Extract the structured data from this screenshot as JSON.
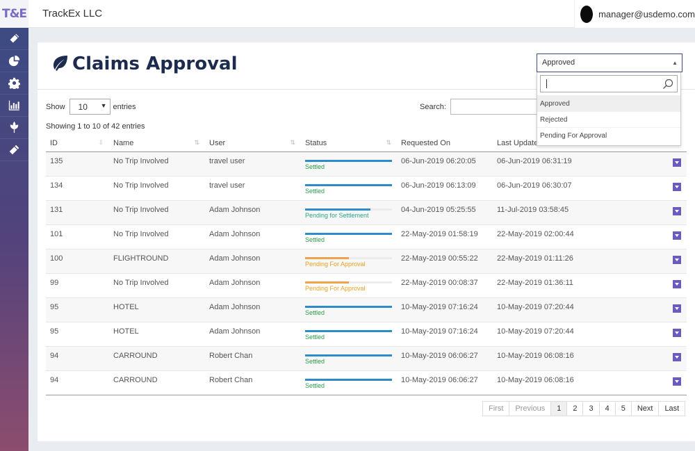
{
  "app": {
    "logo": "T&E",
    "company": "TrackEx LLC",
    "user_email": "manager@usdemo.com"
  },
  "sidebar": {
    "items": [
      {
        "name": "ticket-icon"
      },
      {
        "name": "pie-chart-icon"
      },
      {
        "name": "gear-icon"
      },
      {
        "name": "bar-chart-icon"
      },
      {
        "name": "leaf-icon"
      },
      {
        "name": "tag-icon"
      }
    ]
  },
  "page": {
    "title": "Claims Approval",
    "accent": "#3d4b83"
  },
  "status_filter": {
    "selected": "Approved",
    "options": [
      "Approved",
      "Rejected",
      "Pending For Approval"
    ]
  },
  "controls": {
    "show_label": "Show",
    "entries_value": "10",
    "entries_label": "entries",
    "search_label": "Search:",
    "info": "Showing 1 to 10 of 42 entries"
  },
  "table": {
    "columns": [
      "ID",
      "Name",
      "User",
      "Status",
      "Requested On",
      "Last Updated"
    ],
    "rows": [
      {
        "id": "135",
        "name": "No Trip Involved",
        "user": "travel user",
        "status": "Settled",
        "progress": 1.0,
        "color": "#2e8bc9",
        "text_color": "#2a9a4a",
        "requested": "06-Jun-2019 06:20:05",
        "updated": "06-Jun-2019 06:31:19"
      },
      {
        "id": "134",
        "name": "No Trip Involved",
        "user": "travel user",
        "status": "Settled",
        "progress": 1.0,
        "color": "#2e8bc9",
        "text_color": "#2a9a4a",
        "requested": "06-Jun-2019 06:13:09",
        "updated": "06-Jun-2019 06:30:07"
      },
      {
        "id": "131",
        "name": "No Trip Involved",
        "user": "Adam Johnson",
        "status": "Pending for Settlement",
        "progress": 0.75,
        "color": "#2e8bc9",
        "text_color": "#2aa38a",
        "requested": "04-Jun-2019 05:25:55",
        "updated": "11-Jul-2019 03:58:45"
      },
      {
        "id": "101",
        "name": "No Trip Involved",
        "user": "Adam Johnson",
        "status": "Settled",
        "progress": 1.0,
        "color": "#2e8bc9",
        "text_color": "#2a9a4a",
        "requested": "22-May-2019 01:58:19",
        "updated": "22-May-2019 02:00:44"
      },
      {
        "id": "100",
        "name": "FLIGHTROUND",
        "user": "Adam Johnson",
        "status": "Pending For Approval",
        "progress": 0.5,
        "color": "#f0a24a",
        "text_color": "#e8a020",
        "requested": "22-May-2019 00:55:22",
        "updated": "22-May-2019 01:11:26"
      },
      {
        "id": "99",
        "name": "No Trip Involved",
        "user": "Adam Johnson",
        "status": "Pending For Approval",
        "progress": 0.5,
        "color": "#f0a24a",
        "text_color": "#e8a020",
        "requested": "22-May-2019 00:08:37",
        "updated": "22-May-2019 01:36:11"
      },
      {
        "id": "95",
        "name": "HOTEL",
        "user": "Adam Johnson",
        "status": "Settled",
        "progress": 1.0,
        "color": "#2e8bc9",
        "text_color": "#2a9a4a",
        "requested": "10-May-2019 07:16:24",
        "updated": "10-May-2019 07:20:44"
      },
      {
        "id": "95",
        "name": "HOTEL",
        "user": "Adam Johnson",
        "status": "Settled",
        "progress": 1.0,
        "color": "#2e8bc9",
        "text_color": "#2a9a4a",
        "requested": "10-May-2019 07:16:24",
        "updated": "10-May-2019 07:20:44"
      },
      {
        "id": "94",
        "name": "CARROUND",
        "user": "Robert Chan",
        "status": "Settled",
        "progress": 1.0,
        "color": "#2e8bc9",
        "text_color": "#2a9a4a",
        "requested": "10-May-2019 06:06:27",
        "updated": "10-May-2019 06:08:16"
      },
      {
        "id": "94",
        "name": "CARROUND",
        "user": "Robert Chan",
        "status": "Settled",
        "progress": 1.0,
        "color": "#2e8bc9",
        "text_color": "#2a9a4a",
        "requested": "10-May-2019 06:06:27",
        "updated": "10-May-2019 06:08:16"
      }
    ]
  },
  "pagination": {
    "first": "First",
    "previous": "Previous",
    "pages": [
      "1",
      "2",
      "3",
      "4",
      "5"
    ],
    "active": "1",
    "next": "Next",
    "last": "Last"
  }
}
